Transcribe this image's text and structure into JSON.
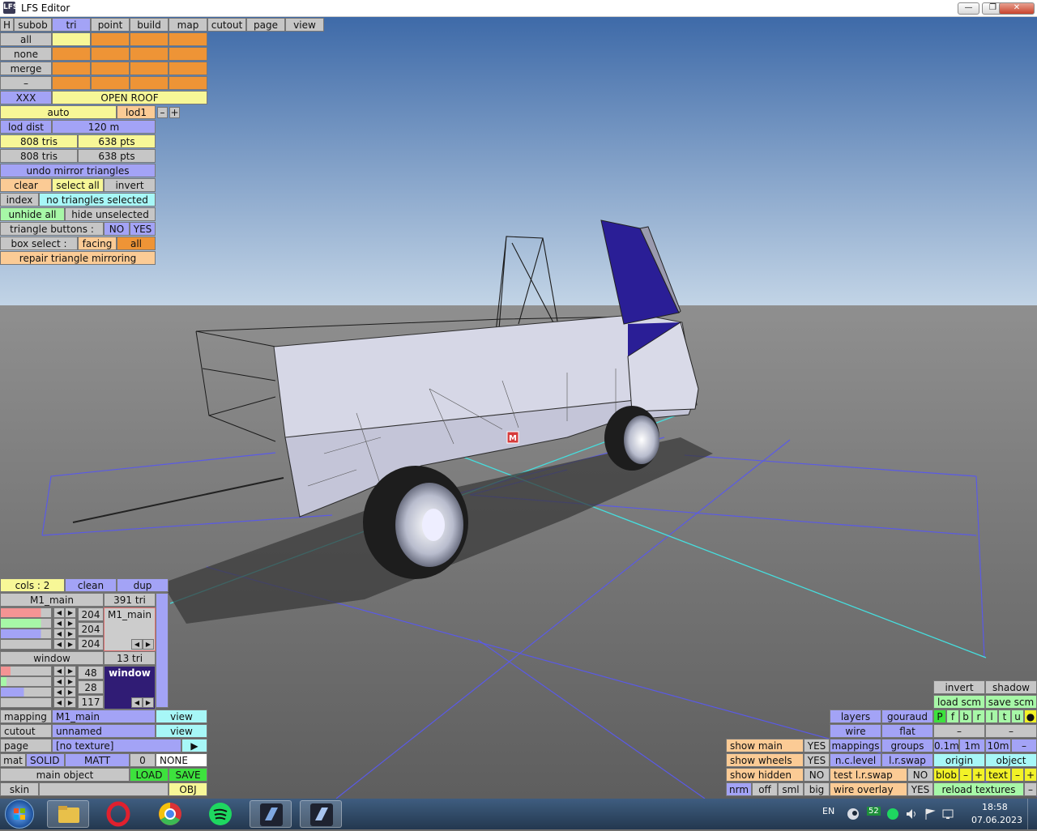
{
  "window": {
    "title": "LFS Editor",
    "minimize": "—",
    "restore": "❐",
    "close": "✕"
  },
  "menu": {
    "h": "H",
    "items": [
      "subob",
      "tri",
      "point",
      "build",
      "map",
      "cutout",
      "page",
      "view"
    ]
  },
  "rows": {
    "all": "all",
    "none": "none",
    "merge": "merge",
    "dash": "–"
  },
  "object_id": "XXX",
  "object_name": "OPEN ROOF",
  "lod": {
    "auto": "auto",
    "level": "lod1",
    "minus": "–",
    "plus": "+"
  },
  "lod_dist": {
    "label": "lod dist",
    "value": "120 m"
  },
  "counts": {
    "r1_tris": "808 tris",
    "r1_pts": "638 pts",
    "r2_tris": "808 tris",
    "r2_pts": "638 pts"
  },
  "tri_panel": {
    "undo": "undo mirror triangles",
    "clear": "clear",
    "select_all": "select all",
    "invert": "invert",
    "index": "index",
    "no_sel": "no triangles selected",
    "unhide": "unhide all",
    "hide_unsel": "hide unselected",
    "tri_buttons": "triangle buttons :",
    "no": "NO",
    "yes": "YES",
    "box_select": "box select :",
    "facing": "facing",
    "all": "all",
    "repair": "repair triangle mirroring"
  },
  "marker": "M",
  "colors_panel": {
    "cols": "cols : 2",
    "clean": "clean",
    "dup": "dup",
    "main_name": "M1_main",
    "main_tris": "391 tri",
    "main_rgb": [
      "204",
      "204",
      "204"
    ],
    "main_swatch": "M1_main",
    "win_name": "window",
    "win_tris": "13 tri",
    "win_rgb": [
      "48",
      "28",
      "117"
    ],
    "win_swatch": "window",
    "main_color": "#cccccc",
    "win_color": "#301c75"
  },
  "mapping": {
    "label": "mapping",
    "value": "M1_main",
    "view": "view"
  },
  "cutout": {
    "label": "cutout",
    "value": "unnamed",
    "view": "view"
  },
  "page": {
    "label": "page",
    "value": "[no texture]",
    "arrow": "▶"
  },
  "mat": {
    "label": "mat",
    "solid": "SOLID",
    "matt": "MATT",
    "num": "0",
    "none": "NONE"
  },
  "main_object": {
    "label": "main object",
    "load": "LOAD",
    "save": "SAVE"
  },
  "skin": {
    "label": "skin",
    "obj": "OBJ"
  },
  "view_panel": {
    "invert": "invert",
    "shadow": "shadow",
    "load_scm": "load scm",
    "save_scm": "save scm",
    "letters": [
      "P",
      "f",
      "b",
      "r",
      "l",
      "t",
      "u",
      "●"
    ],
    "layers": "layers",
    "gouraud": "gouraud",
    "wire": "wire",
    "flat": "flat",
    "dash": "–",
    "show_main": "show main",
    "yes1": "YES",
    "mappings": "mappings",
    "groups": "groups",
    "m01": "0.1m",
    "m1": "1m",
    "m10": "10m",
    "show_wheels": "show wheels",
    "yes2": "YES",
    "nclevel": "n.c.level",
    "lrswap": "l.r.swap",
    "origin": "origin",
    "object": "object",
    "show_hidden": "show hidden",
    "no1": "NO",
    "test_lr": "test l.r.swap",
    "no2": "NO",
    "blob": "blob",
    "minus": "–",
    "plus": "+",
    "text": "text",
    "nrm": "nrm",
    "off": "off",
    "sml": "sml",
    "big": "big",
    "wire_overlay": "wire overlay",
    "yes3": "YES",
    "reload": "reload textures"
  },
  "taskbar": {
    "apps": [
      "explorer-icon",
      "opera-icon",
      "chrome-icon",
      "spotify-icon",
      "lfs-icon",
      "lfs-editor-icon"
    ],
    "lang": "EN",
    "badge": "52",
    "time": "18:58",
    "date": "07.06.2023"
  }
}
